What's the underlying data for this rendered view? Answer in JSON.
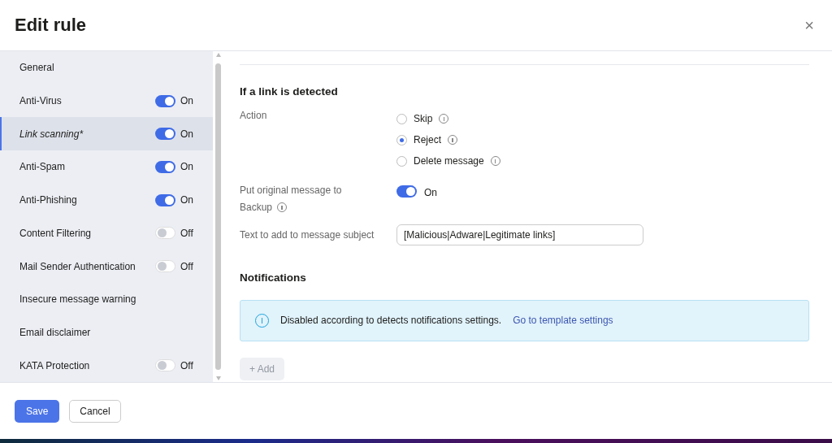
{
  "dialog": {
    "title": "Edit rule",
    "close": "×"
  },
  "sidebar": {
    "items": [
      {
        "label": "General",
        "selected": false,
        "italic": false
      },
      {
        "label": "Anti-Virus",
        "selected": false,
        "italic": false,
        "toggle": {
          "on": true,
          "label": "On"
        }
      },
      {
        "label": "Link scanning*",
        "selected": true,
        "italic": true,
        "toggle": {
          "on": true,
          "label": "On"
        }
      },
      {
        "label": "Anti-Spam",
        "selected": false,
        "italic": false,
        "toggle": {
          "on": true,
          "label": "On"
        }
      },
      {
        "label": "Anti-Phishing",
        "selected": false,
        "italic": false,
        "toggle": {
          "on": true,
          "label": "On"
        }
      },
      {
        "label": "Content Filtering",
        "selected": false,
        "italic": false,
        "toggle": {
          "on": false,
          "label": "Off"
        }
      },
      {
        "label": "Mail Sender Authentication",
        "selected": false,
        "italic": false,
        "toggle": {
          "on": false,
          "label": "Off"
        }
      },
      {
        "label": "Insecure message warning",
        "selected": false,
        "italic": false
      },
      {
        "label": "Email disclaimer",
        "selected": false,
        "italic": false
      },
      {
        "label": "KATA Protection",
        "selected": false,
        "italic": false,
        "toggle": {
          "on": false,
          "label": "Off"
        }
      }
    ]
  },
  "content": {
    "section_title": "If a link is detected",
    "action": {
      "label": "Action",
      "options": [
        {
          "label": "Skip",
          "selected": false
        },
        {
          "label": "Reject",
          "selected": true
        },
        {
          "label": "Delete message",
          "selected": false
        }
      ]
    },
    "backup": {
      "label": "Put original message to",
      "label_line2": "Backup",
      "on": true,
      "state_label": "On"
    },
    "subject": {
      "label": "Text to add to message subject",
      "value": "[Malicious|Adware|Legitimate links]"
    },
    "notifications": {
      "title": "Notifications",
      "alert": "Disabled according to detects notifications settings.",
      "link": "Go to template settings",
      "add_button": {
        "label": "Add",
        "icon": "+",
        "disabled": true
      }
    }
  },
  "footer": {
    "buttons": [
      {
        "label": "Save",
        "kind": "primary"
      },
      {
        "label": "Cancel",
        "kind": "secondary"
      }
    ]
  }
}
